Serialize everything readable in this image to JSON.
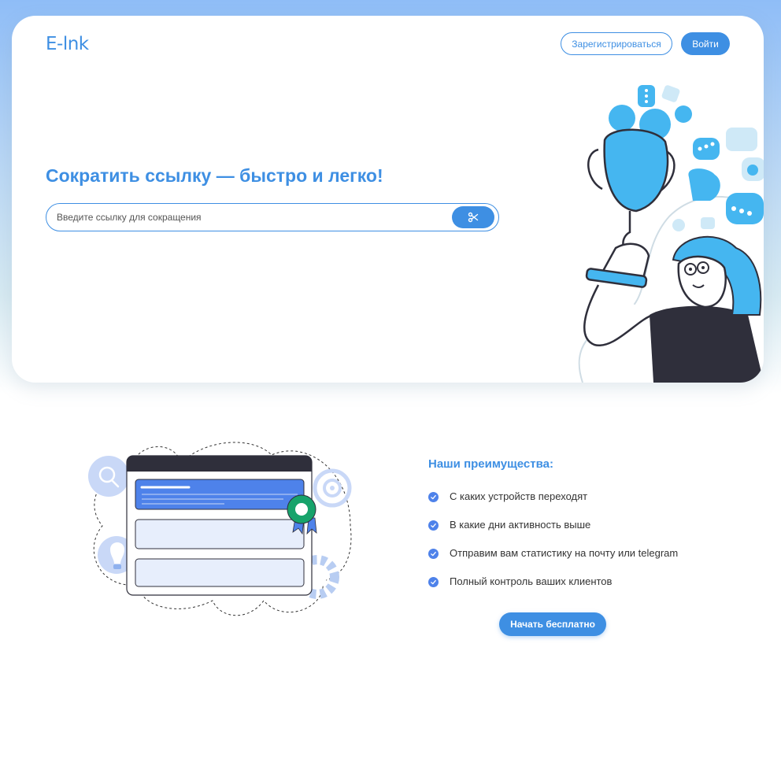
{
  "header": {
    "logo": "E-lnk",
    "register_label": "Зарегистрироваться",
    "login_label": "Войти"
  },
  "hero": {
    "title": "Сократить ссылку — быстро и легко!",
    "search": {
      "placeholder": "Введите ссылку для сокращения",
      "value": ""
    },
    "cut_icon": "scissors-icon"
  },
  "advantages": {
    "title": "Наши преимущества:",
    "items": [
      "С каких устройств переходят",
      "В какие дни активность выше",
      "Отправим вам статистику на почту или telegram",
      "Полный контроль ваших клиентов"
    ],
    "cta_label": "Начать бесплатно"
  },
  "colors": {
    "accent": "#3e8fe3",
    "illustration_blue": "#45b6f0",
    "dark": "#2f2f3b"
  }
}
